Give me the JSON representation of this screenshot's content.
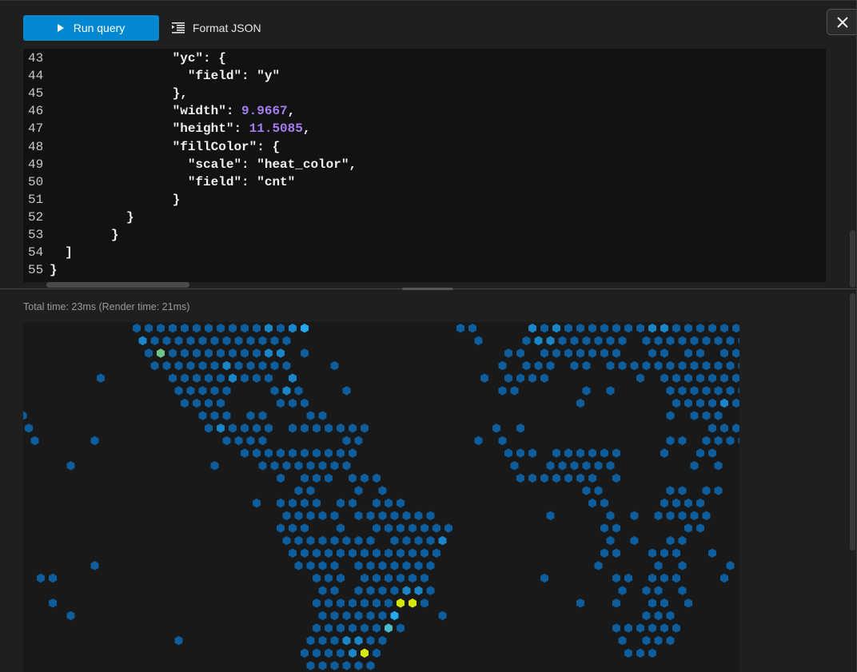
{
  "toolbar": {
    "run_label": "Run query",
    "format_label": "Format JSON",
    "close_icon": "close-icon"
  },
  "editor": {
    "lines": [
      {
        "n": "43",
        "pre": "                \"yc\": {",
        "num": "",
        "post": ""
      },
      {
        "n": "44",
        "pre": "                  \"field\": \"y\"",
        "num": "",
        "post": ""
      },
      {
        "n": "45",
        "pre": "                },",
        "num": "",
        "post": ""
      },
      {
        "n": "46",
        "pre": "                \"width\": ",
        "num": "9.9667",
        "post": ","
      },
      {
        "n": "47",
        "pre": "                \"height\": ",
        "num": "11.5085",
        "post": ","
      },
      {
        "n": "48",
        "pre": "                \"fillColor\": {",
        "num": "",
        "post": ""
      },
      {
        "n": "49",
        "pre": "                  \"scale\": \"heat_color\",",
        "num": "",
        "post": ""
      },
      {
        "n": "50",
        "pre": "                  \"field\": \"cnt\"",
        "num": "",
        "post": ""
      },
      {
        "n": "51",
        "pre": "                }",
        "num": "",
        "post": ""
      },
      {
        "n": "52",
        "pre": "          }",
        "num": "",
        "post": ""
      },
      {
        "n": "53",
        "pre": "        }",
        "num": "",
        "post": ""
      },
      {
        "n": "54",
        "pre": "  ]",
        "num": "",
        "post": ""
      },
      {
        "n": "55",
        "pre": "}",
        "num": "",
        "post": ""
      }
    ]
  },
  "results": {
    "timing": "Total time: 23ms (Render time: 21ms)"
  },
  "colors": {
    "accent": "#0288d1",
    "number": "#a67cf2"
  },
  "chart_data": {
    "type": "heatmap",
    "mark": "hexbin",
    "color_scale": "heat_color",
    "legend": {
      "1": "#0e5d9c",
      "2": "#1a86c9",
      "3": "#25a9ef",
      "g": "#6cc68a",
      "t": "#4cb9c9",
      "y": "#d5e80a"
    },
    "rows": [
      "...........111111111112123............11....2121111111221111111",
      "...........2111111111111...............1...122111111.1111111111",
      "............1g1111111122.1................11.1111111..11.11.111",
      "............111111211111...1.............1.111.11.111111111111",
      "........1.....111112111.2...............1.1111.......1.11111111",
      "..............11111...121...1............11.....1.1....1111111",
      "...............1111....111......................1.......111121",
      ".1..............111.11...11............................1.111..",
      "..1..............121111.1111111..........1.1...............111.",
      "..1....1..........1111......11.........1.1.............11.1111",
      "....................1111111111............111.111111...1..11..",
      ".....1...........1...11111111.............1..111111......1.1..",
      ".......................1.111.111...........1111111.1..........",
      "........................11...1.1................11.....11.11..",
      ".....................1.1111.11.111...............11....1111...",
      ".......................11111.1111111.........1....1.1.11111...",
      ".......................111..1..1111111............11.....11...",
      ".......................11111111.11112.............1.1..11.....",
      "........................1111111111111.............11..111..1..",
      ".......1................1111.1111111.............1....1.1...1.",
      "...11.....................111.111111.........1.....11.111...1.",
      "..........................11.1111221...............1.11.1.....",
      "....1.....................1111111yy1............1..1..11.1....",
      ".....1....................1111113...1................111......",
      "..........................111111t1.................111111.....",
      "..............1..........1112211...................1.111......",
      ".........................11112y1....................111.......",
      ".........................111111..............................."
    ]
  }
}
